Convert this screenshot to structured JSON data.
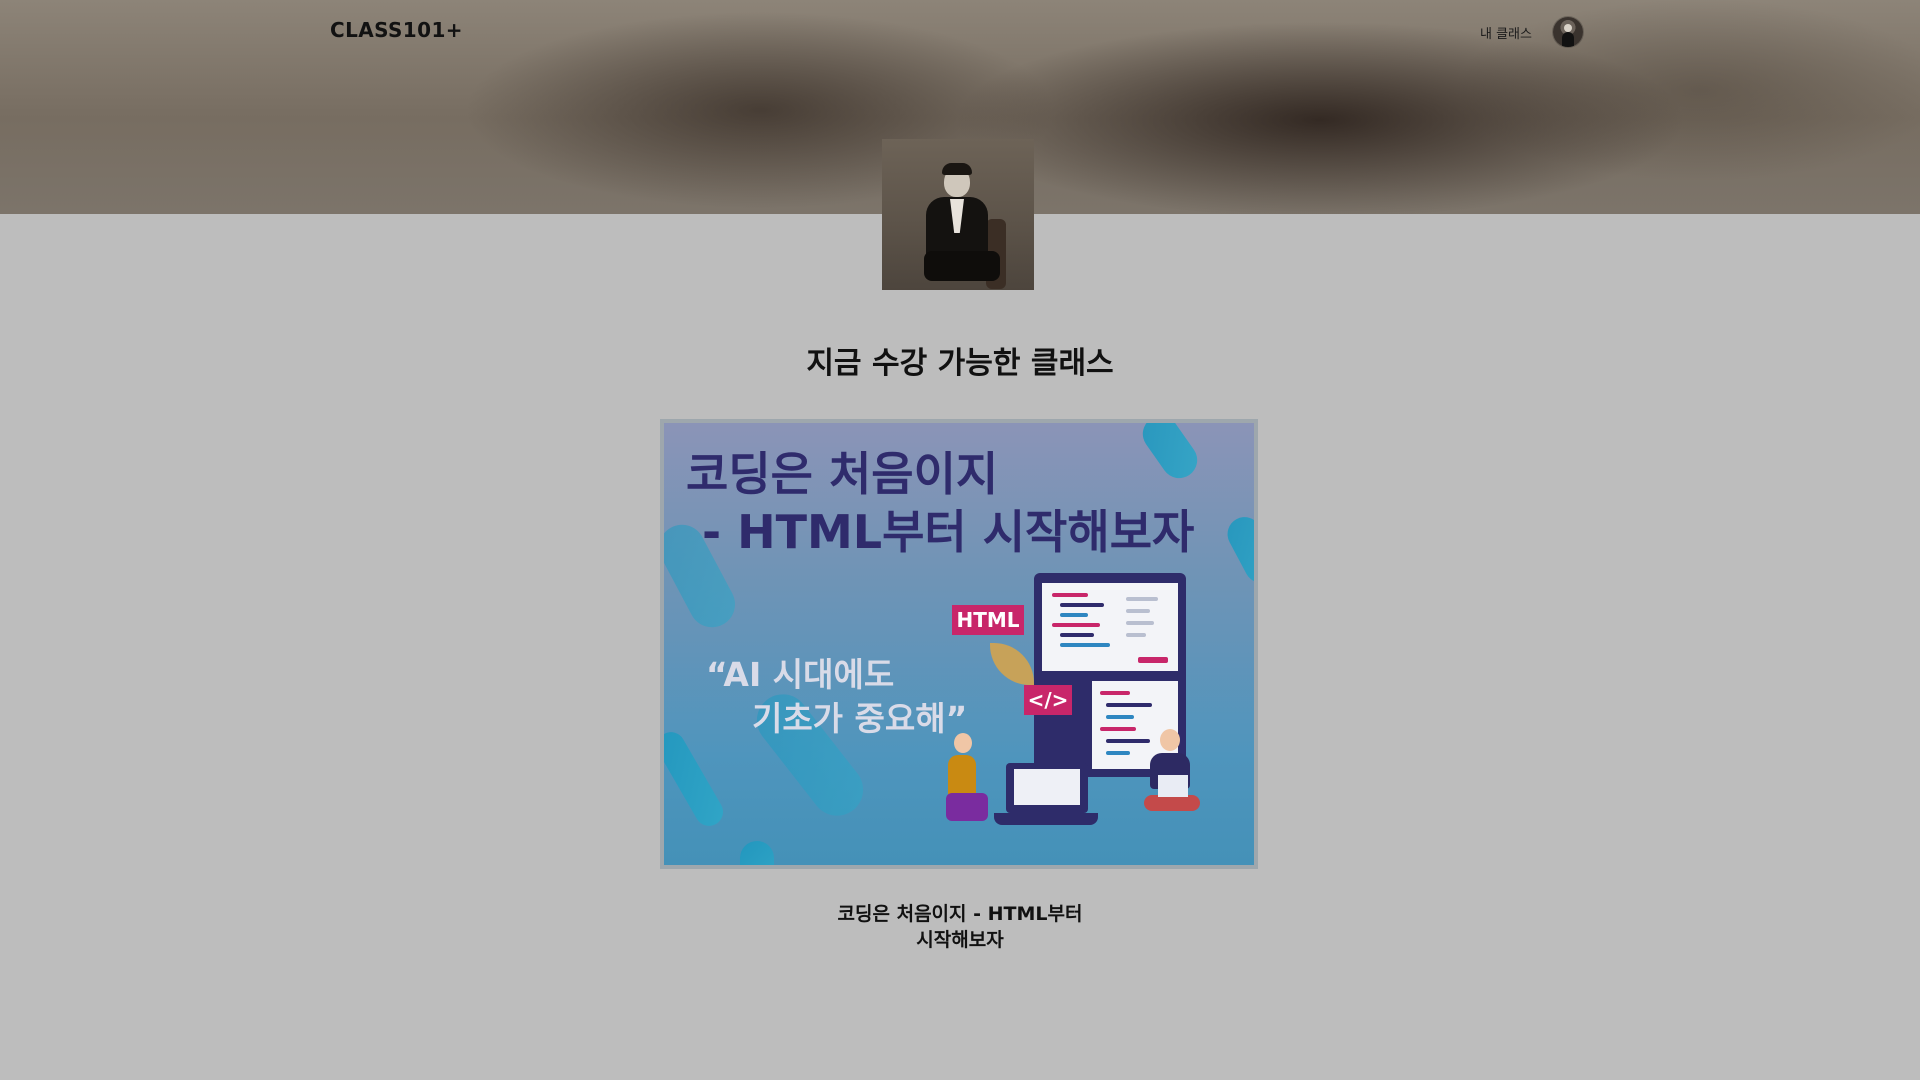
{
  "header": {
    "brand": "CLASS101+",
    "my_class_link": "내 클래스"
  },
  "section": {
    "title": "지금 수강 가능한 클래스"
  },
  "class_card": {
    "thumbnail_title": "코딩은 처음이지\n - HTML부터 시작해보자",
    "thumbnail_quote": "“AI 시대에도\n    기초가 중요해”",
    "html_badge": "HTML",
    "tag_badge": "</>",
    "name": "코딩은 처음이지 - HTML부터\n시작해보자"
  },
  "colors": {
    "page_background": "#bdbdbd",
    "thumbnail_title": "#2f2b6c",
    "badge": "#c8266a"
  },
  "icons": {
    "user_avatar": "avatar",
    "profile_photo": "instructor-photo"
  }
}
